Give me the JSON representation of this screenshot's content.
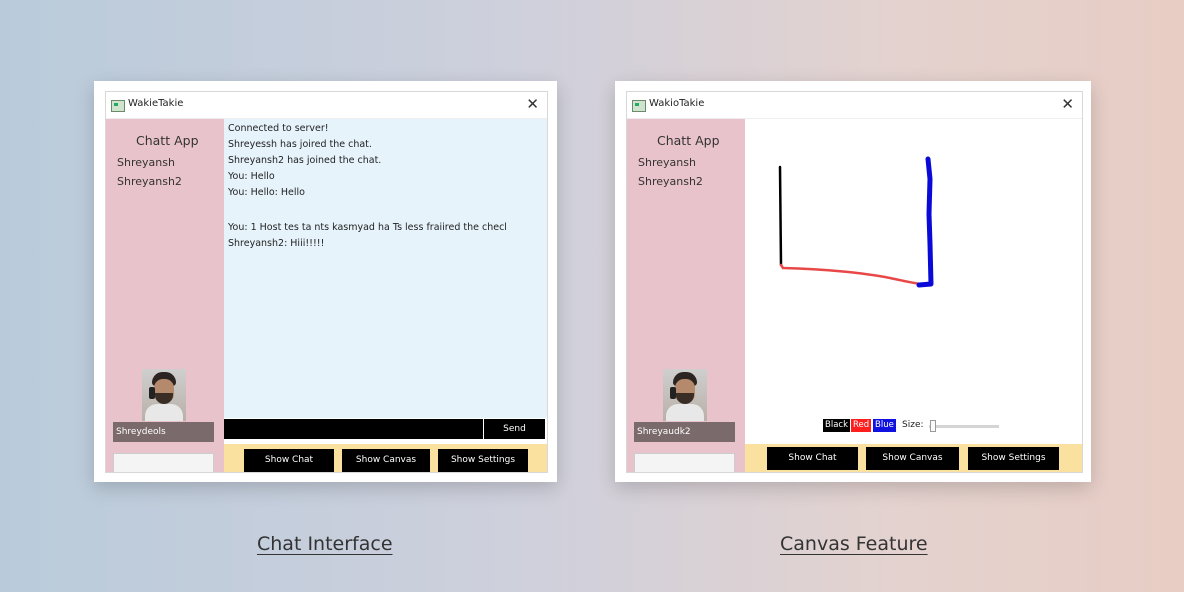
{
  "left_panel": {
    "window_title": "WakieTakie",
    "close_glyph": "✕",
    "app_title": "Chatt App",
    "users": [
      "Shreyansh",
      "Shreyansh2"
    ],
    "chat_lines": [
      "Connected to server!",
      "Shreyessh has joired the chat.",
      "Shreyansh2 has joined the chat.",
      "You: Hello",
      "You: Hello: Hello",
      "",
      "You: 1 Host tes ta nts kasmyad ha Ts less fraiired the checl",
      "Shreyansh2: Hiii!!!!!"
    ],
    "profile_name": "Shreydeols",
    "send_label": "Send",
    "nav": [
      "Show Chat",
      "Show Canvas",
      "Show Settings"
    ]
  },
  "right_panel": {
    "window_title": "WakioTakie",
    "close_glyph": "✕",
    "app_title": "Chatt App",
    "users": [
      "Shreyansh",
      "Shreyansh2"
    ],
    "profile_name": "Shreyaudk2",
    "colors": [
      {
        "label": "Black",
        "hex": "#000000"
      },
      {
        "label": "Red",
        "hex": "#ff1e1e"
      },
      {
        "label": "Blue",
        "hex": "#1010e0"
      }
    ],
    "size_label": "Size:",
    "nav": [
      "Show Chat",
      "Show Canvas",
      "Show Settings"
    ]
  },
  "captions": {
    "left": "Chat Interface",
    "right": "Canvas Feature"
  },
  "icons": {
    "window_icon": "app-window-icon",
    "close_icon": "close-icon"
  }
}
